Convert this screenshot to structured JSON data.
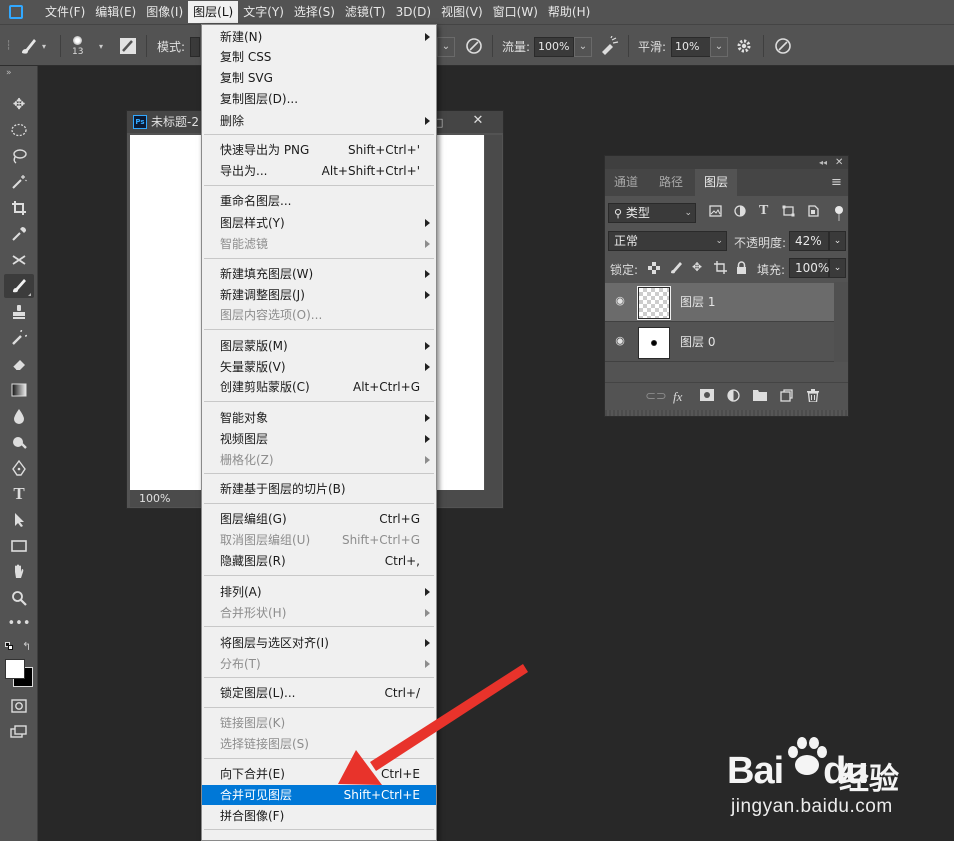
{
  "menubar": {
    "items": [
      "文件(F)",
      "编辑(E)",
      "图像(I)",
      "图层(L)",
      "文字(Y)",
      "选择(S)",
      "滤镜(T)",
      "3D(D)",
      "视图(V)",
      "窗口(W)",
      "帮助(H)"
    ]
  },
  "options_bar": {
    "brush_size": "13",
    "mode_label": "模式:",
    "flow_label": "流量:",
    "flow_value": "100%",
    "smoothing_label": "平滑:",
    "smoothing_value": "10%"
  },
  "document": {
    "title": "未标题-2",
    "zoom": "100%",
    "close_glyph": "✕",
    "max_glyph": "□"
  },
  "layer_menu": {
    "items": [
      {
        "label": "新建(N)",
        "submenu": true
      },
      {
        "label": "复制 CSS"
      },
      {
        "label": "复制 SVG"
      },
      {
        "label": "复制图层(D)..."
      },
      {
        "label": "删除",
        "submenu": true
      },
      {
        "label": "快速导出为 PNG",
        "shortcut": "Shift+Ctrl+'"
      },
      {
        "label": "导出为...",
        "shortcut": "Alt+Shift+Ctrl+'"
      },
      {
        "label": "重命名图层..."
      },
      {
        "label": "图层样式(Y)",
        "submenu": true
      },
      {
        "label": "智能滤镜",
        "submenu": true,
        "disabled": true
      },
      {
        "label": "新建填充图层(W)",
        "submenu": true
      },
      {
        "label": "新建调整图层(J)",
        "submenu": true
      },
      {
        "label": "图层内容选项(O)...",
        "disabled": true
      },
      {
        "label": "图层蒙版(M)",
        "submenu": true
      },
      {
        "label": "矢量蒙版(V)",
        "submenu": true
      },
      {
        "label": "创建剪贴蒙版(C)",
        "shortcut": "Alt+Ctrl+G"
      },
      {
        "label": "智能对象",
        "submenu": true
      },
      {
        "label": "视频图层",
        "submenu": true
      },
      {
        "label": "栅格化(Z)",
        "submenu": true,
        "disabled": true
      },
      {
        "label": "新建基于图层的切片(B)"
      },
      {
        "label": "图层编组(G)",
        "shortcut": "Ctrl+G"
      },
      {
        "label": "取消图层编组(U)",
        "shortcut": "Shift+Ctrl+G",
        "disabled": true
      },
      {
        "label": "隐藏图层(R)",
        "shortcut": "Ctrl+,"
      },
      {
        "label": "排列(A)",
        "submenu": true
      },
      {
        "label": "合并形状(H)",
        "submenu": true,
        "disabled": true
      },
      {
        "label": "将图层与选区对齐(I)",
        "submenu": true
      },
      {
        "label": "分布(T)",
        "submenu": true,
        "disabled": true
      },
      {
        "label": "锁定图层(L)...",
        "shortcut": "Ctrl+/"
      },
      {
        "label": "链接图层(K)",
        "disabled": true
      },
      {
        "label": "选择链接图层(S)",
        "disabled": true
      },
      {
        "label": "向下合并(E)",
        "shortcut": "Ctrl+E"
      },
      {
        "label": "合并可见图层",
        "shortcut": "Shift+Ctrl+E",
        "highlighted": true
      },
      {
        "label": "拼合图像(F)"
      }
    ]
  },
  "layers_panel": {
    "tabs": [
      "通道",
      "路径",
      "图层"
    ],
    "active_tab": "图层",
    "filter_label": "类型",
    "blend_mode": "正常",
    "opacity_label": "不透明度:",
    "opacity_value": "42%",
    "lock_label": "锁定:",
    "fill_label": "填充:",
    "fill_value": "100%",
    "layers": [
      {
        "name": "图层 1",
        "selected": true,
        "visible": true
      },
      {
        "name": "图层 0",
        "selected": false,
        "visible": true
      }
    ]
  },
  "watermark": {
    "logo": "Bai",
    "logo_tail": "du",
    "cn": "经验",
    "url": "jingyan.baidu.com"
  },
  "colors": {
    "highlight": "#0078d7",
    "arrow": "#e8332b",
    "ps_blue": "#31a8ff"
  }
}
